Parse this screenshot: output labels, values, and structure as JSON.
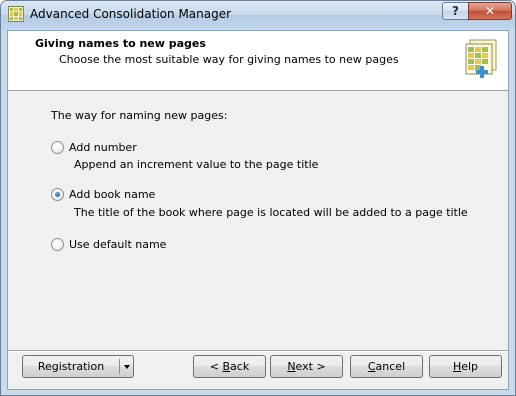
{
  "window": {
    "title": "Advanced Consolidation Manager",
    "help_caption": "?",
    "close_caption": "✕"
  },
  "header": {
    "title": "Giving names to new pages",
    "subtitle": "Choose the most suitable way for giving names to new pages",
    "icon": "spreadsheet-add-icon"
  },
  "main": {
    "section_label": "The way for naming new pages:",
    "options": [
      {
        "label": "Add number",
        "description": "Append an increment value to the page title",
        "checked": false
      },
      {
        "label": "Add book name",
        "description": "The title of the book where page is located will be added to a page title",
        "checked": true
      },
      {
        "label": "Use default name",
        "description": "",
        "checked": false
      }
    ]
  },
  "footer": {
    "registration_label": "Registration",
    "back_prefix": "< ",
    "back_accel": "B",
    "back_rest": "ack",
    "next_accel": "N",
    "next_rest": "ext >",
    "cancel_accel": "C",
    "cancel_rest": "ancel",
    "help_accel": "H",
    "help_rest": "elp"
  },
  "colors": {
    "accent": "#2d6cc0",
    "close_button": "#c24e35"
  }
}
